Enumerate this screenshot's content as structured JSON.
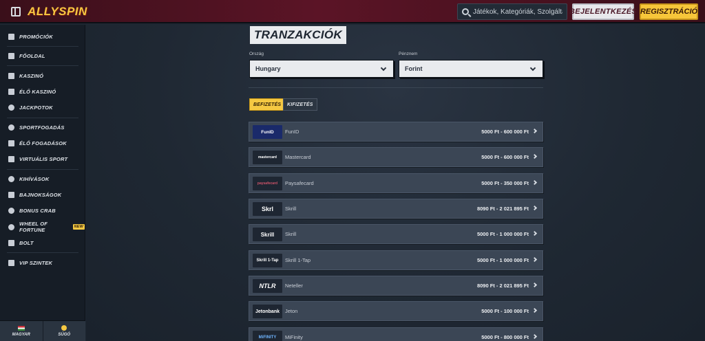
{
  "header": {
    "logo_text": "ALLYSPIN",
    "search_placeholder": "Játékok, Kategóriák, Szolgáltatók",
    "login_label": "BEJELENTKEZÉS",
    "register_label": "REGISZTRÁCIÓ"
  },
  "sidebar": {
    "items": [
      {
        "label": "PROMÓCIÓK",
        "icon": "gift-icon"
      },
      {
        "label": "FŐOLDAL",
        "icon": "home-icon"
      },
      {
        "label": "KASZINÓ",
        "icon": "slot-machine-icon"
      },
      {
        "label": "ÉLŐ KASZINÓ",
        "icon": "cards-icon"
      },
      {
        "label": "JACKPOTOK",
        "icon": "clover-icon"
      },
      {
        "label": "SPORTFOGADÁS",
        "icon": "football-icon"
      },
      {
        "label": "ÉLŐ FOGADÁSOK",
        "icon": "live-icon"
      },
      {
        "label": "VIRTUÁLIS SPORT",
        "icon": "virtual-icon"
      },
      {
        "label": "KIHÍVÁSOK",
        "icon": "medal-icon"
      },
      {
        "label": "BAJNOKSÁGOK",
        "icon": "trophy-icon"
      },
      {
        "label": "BONUS CRAB",
        "icon": "crab-icon"
      },
      {
        "label": "WHEEL OF FORTUNE",
        "icon": "wheel-icon",
        "badge": "NEW"
      },
      {
        "label": "BOLT",
        "icon": "cart-icon"
      },
      {
        "label": "VIP SZINTEK",
        "icon": "diamond-icon"
      }
    ],
    "bottom": {
      "language_label": "MAGYAR",
      "help_label": "SÚGÓ"
    }
  },
  "main": {
    "title": "TRANZAKCIÓK",
    "country_label": "Ország",
    "country_value": "Hungary",
    "currency_label": "Pénznem",
    "currency_value": "Forint",
    "tabs": [
      {
        "label": "BEFIZETÉS",
        "active": true
      },
      {
        "label": "KIFIZETÉS",
        "active": false
      }
    ],
    "methods": [
      {
        "logo": "FunID",
        "name": "FunID",
        "range": "5000 Ft - 600 000 Ft"
      },
      {
        "logo": "mastercard",
        "name": "Mastercard",
        "range": "5000 Ft - 600 000 Ft"
      },
      {
        "logo": "paysafecard",
        "name": "Paysafecard",
        "range": "5000 Ft - 350 000 Ft"
      },
      {
        "logo": "Skrl",
        "name": "Skrill",
        "range": "8090 Ft - 2 021 895 Ft"
      },
      {
        "logo": "Skrill",
        "name": "Skrill",
        "range": "5000 Ft - 1 000 000 Ft"
      },
      {
        "logo": "Skrill 1-Tap",
        "name": "Skrill 1-Tap",
        "range": "5000 Ft - 1 000 000 Ft"
      },
      {
        "logo": "NTLR",
        "name": "Neteller",
        "range": "8090 Ft - 2 021 895 Ft"
      },
      {
        "logo": "Jetonbank",
        "name": "Jeton",
        "range": "5000 Ft - 100 000 Ft"
      },
      {
        "logo": "MiFINITY",
        "name": "MiFinity",
        "range": "5000 Ft - 800 000 Ft"
      }
    ]
  }
}
